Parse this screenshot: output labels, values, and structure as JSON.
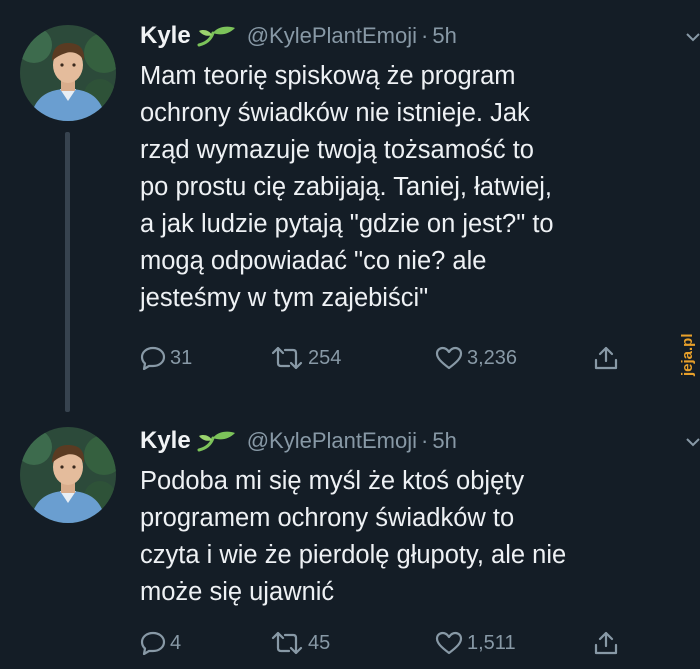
{
  "tweets": [
    {
      "name": "Kyle",
      "handle": "@KylePlantEmoji",
      "separator": "·",
      "time": "5h",
      "lines": [
        "Mam teorię spiskową że program",
        "ochrony świadków nie istnieje. Jak",
        "rząd wymazuje twoją tożsamość to",
        "po prostu cię zabijają. Taniej, łatwiej,",
        "a jak ludzie pytają \"gdzie on jest?\" to",
        "mogą odpowiadać \"co nie? ale",
        "jesteśmy w tym zajebiści\""
      ],
      "replies": "31",
      "retweets": "254",
      "likes": "3,236"
    },
    {
      "name": "Kyle",
      "handle": "@KylePlantEmoji",
      "separator": "·",
      "time": "5h",
      "lines": [
        "Podoba mi się myśl że ktoś objęty",
        "programem ochrony świadków to",
        "czyta i wie że pierdolę głupoty, ale nie",
        "może się ujawnić"
      ],
      "replies": "4",
      "retweets": "45",
      "likes": "1,511"
    }
  ],
  "icons": {
    "sprout": "seedling-icon",
    "reply": "reply-icon",
    "retweet": "retweet-icon",
    "like": "heart-icon",
    "share": "share-icon",
    "menu": "chevron-down-icon"
  },
  "colors": {
    "background": "#141d26",
    "text": "#eef1f4",
    "muted": "#8899a6",
    "sprout": "#7cc35a",
    "watermark": "#e8a02a"
  },
  "watermark": "jeja.pl"
}
